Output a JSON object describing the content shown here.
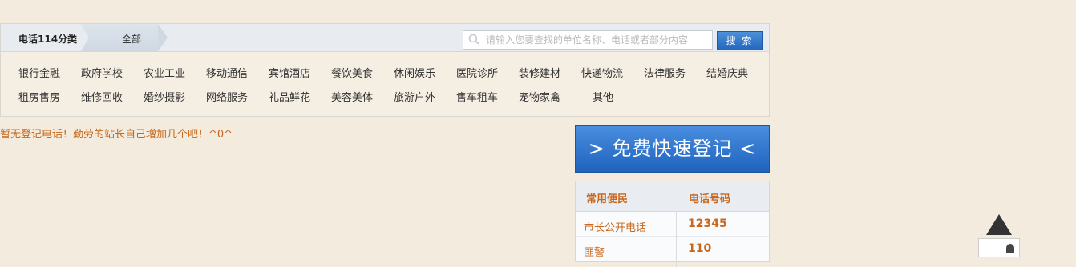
{
  "breadcrumb": {
    "category": "电话114分类",
    "current": "全部"
  },
  "search": {
    "placeholder": "请输入您要查找的单位名称、电话或者部分内容",
    "button_label": "搜 索"
  },
  "categories": {
    "row1": [
      "银行金融",
      "政府学校",
      "农业工业",
      "移动通信",
      "宾馆酒店",
      "餐饮美食",
      "休闲娱乐",
      "医院诊所",
      "装修建材",
      "快递物流",
      "法律服务",
      "结婚庆典"
    ],
    "row2": [
      "租房售房",
      "维修回收",
      "婚纱摄影",
      "网络服务",
      "礼品鲜花",
      "美容美体",
      "旅游户外",
      "售车租车",
      "宠物家禽",
      "其他"
    ]
  },
  "notice": "暂无登记电话！勤劳的站长自己增加几个吧！^0^",
  "register_button": "> 免费快速登记 <",
  "phone_table": {
    "header": [
      "常用便民",
      "电话号码"
    ],
    "rows": [
      {
        "name": "市长公开电话",
        "number": "12345"
      },
      {
        "name": "匪警",
        "number": "110"
      }
    ]
  },
  "colors": {
    "accent": "#c8671d",
    "button_blue": "#2468bf",
    "background": "#f3ebdd"
  },
  "icons": {
    "search": "magnifier-icon",
    "back_to_top": "up-arrow-icon"
  }
}
